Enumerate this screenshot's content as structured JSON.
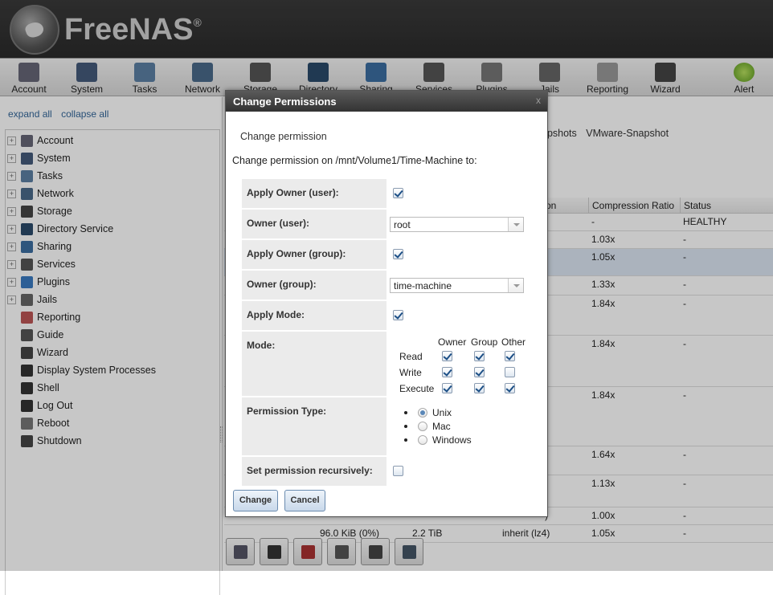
{
  "app": {
    "brand": "FreeNAS",
    "trademark": "®"
  },
  "topnav": [
    {
      "label": "Account",
      "icon": "account-icon"
    },
    {
      "label": "System",
      "icon": "system-icon"
    },
    {
      "label": "Tasks",
      "icon": "tasks-icon"
    },
    {
      "label": "Network",
      "icon": "network-icon"
    },
    {
      "label": "Storage",
      "icon": "storage-icon"
    },
    {
      "label": "Directory",
      "icon": "directory-icon"
    },
    {
      "label": "Sharing",
      "icon": "sharing-icon"
    },
    {
      "label": "Services",
      "icon": "services-icon"
    },
    {
      "label": "Plugins",
      "icon": "plugins-icon"
    },
    {
      "label": "Jails",
      "icon": "jails-icon"
    },
    {
      "label": "Reporting",
      "icon": "reporting-icon"
    },
    {
      "label": "Wizard",
      "icon": "wizard-icon"
    },
    {
      "label": "Alert",
      "icon": "alert-icon"
    }
  ],
  "sidebar": {
    "expand_all": "expand all",
    "collapse_all": "collapse all",
    "items": [
      {
        "label": "Account",
        "expandable": true
      },
      {
        "label": "System",
        "expandable": true
      },
      {
        "label": "Tasks",
        "expandable": true
      },
      {
        "label": "Network",
        "expandable": true
      },
      {
        "label": "Storage",
        "expandable": true
      },
      {
        "label": "Directory Service",
        "expandable": true
      },
      {
        "label": "Sharing",
        "expandable": true
      },
      {
        "label": "Services",
        "expandable": true
      },
      {
        "label": "Plugins",
        "expandable": true
      },
      {
        "label": "Jails",
        "expandable": true
      },
      {
        "label": "Reporting",
        "expandable": false
      },
      {
        "label": "Guide",
        "expandable": false
      },
      {
        "label": "Wizard",
        "expandable": false
      },
      {
        "label": "Display System Processes",
        "expandable": false
      },
      {
        "label": "Shell",
        "expandable": false
      },
      {
        "label": "Log Out",
        "expandable": false
      },
      {
        "label": "Reboot",
        "expandable": false
      },
      {
        "label": "Shutdown",
        "expandable": false
      }
    ]
  },
  "main": {
    "tabs": [
      "apshots",
      "VMware-Snapshot"
    ],
    "columns": [
      "on",
      "Compression Ratio",
      "Status"
    ],
    "rows": [
      {
        "c1": "",
        "ratio": "-",
        "status": "HEALTHY"
      },
      {
        "c1": "",
        "ratio": "1.03x",
        "status": "-"
      },
      {
        "c1": ")",
        "ratio": "1.05x",
        "status": "-"
      },
      {
        "c1": ")",
        "ratio": "1.33x",
        "status": "-"
      },
      {
        "c1": ")",
        "ratio": "1.84x",
        "status": "-"
      },
      {
        "c1": ")",
        "ratio": "1.84x",
        "status": "-"
      },
      {
        "c1": ")",
        "ratio": "1.84x",
        "status": "-"
      },
      {
        "c1": ")",
        "ratio": "1.64x",
        "status": "-"
      },
      {
        "c1": ")",
        "ratio": "1.13x",
        "status": "-"
      },
      {
        "c1": ")",
        "ratio": "1.00x",
        "status": "-"
      }
    ],
    "last_row": {
      "used": "96.0 KiB (0%)",
      "avail": "2.2 TiB",
      "compression": "inherit (lz4)",
      "ratio": "1.05x",
      "status": "-"
    }
  },
  "toolbar": [
    "detach-volume-icon",
    "create-dataset-icon",
    "delete-volume-icon",
    "scrub-volume-icon",
    "create-zvol-icon",
    "view-disks-icon"
  ],
  "dialog": {
    "title": "Change Permissions",
    "close": "x",
    "tab": "Change permission",
    "description": "Change permission on /mnt/Volume1/Time-Machine to:",
    "apply_owner_user": {
      "label": "Apply Owner (user):",
      "checked": true
    },
    "owner_user": {
      "label": "Owner (user):",
      "value": "root"
    },
    "apply_owner_group": {
      "label": "Apply Owner (group):",
      "checked": true
    },
    "owner_group": {
      "label": "Owner (group):",
      "value": "time-machine"
    },
    "apply_mode": {
      "label": "Apply Mode:",
      "checked": true
    },
    "mode": {
      "label": "Mode:",
      "headers": [
        "Owner",
        "Group",
        "Other"
      ],
      "rows": [
        {
          "label": "Read",
          "values": [
            true,
            true,
            true
          ]
        },
        {
          "label": "Write",
          "values": [
            true,
            true,
            false
          ]
        },
        {
          "label": "Execute",
          "values": [
            true,
            true,
            true
          ]
        }
      ]
    },
    "permission_type": {
      "label": "Permission Type:",
      "options": [
        "Unix",
        "Mac",
        "Windows"
      ],
      "selected": "Unix"
    },
    "recursive": {
      "label": "Set permission recursively:",
      "checked": false
    },
    "change_button": "Change",
    "cancel_button": "Cancel"
  }
}
